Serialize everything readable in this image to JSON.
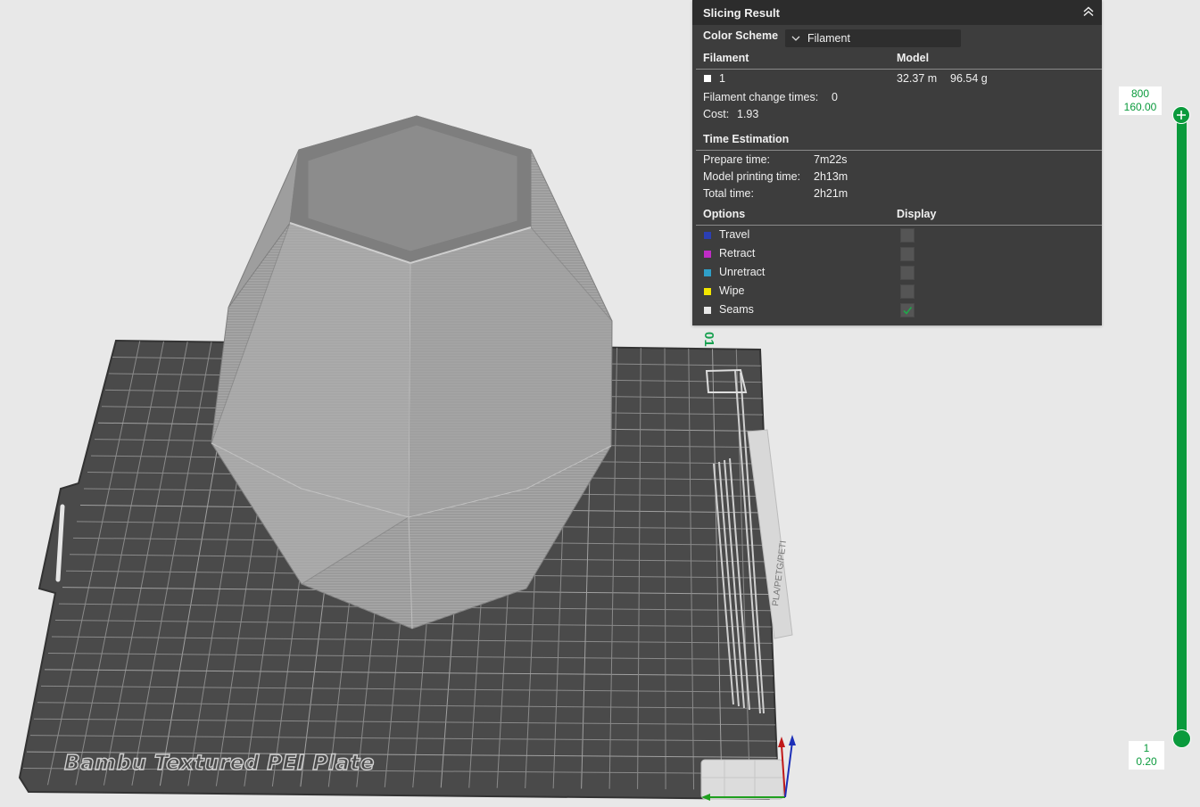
{
  "panel": {
    "title": "Slicing Result",
    "color_scheme_label": "Color Scheme",
    "color_scheme_value": "Filament",
    "filament_header": "Filament",
    "model_header": "Model",
    "filament_id": "1",
    "filament_length": "32.37 m",
    "filament_weight": "96.54 g",
    "change_times_label": "Filament change times:",
    "change_times_value": "0",
    "cost_label": "Cost:",
    "cost_value": "1.93",
    "time_header": "Time Estimation",
    "prepare_label": "Prepare time:",
    "prepare_value": "7m22s",
    "model_print_label": "Model printing time:",
    "model_print_value": "2h13m",
    "total_label": "Total time:",
    "total_value": "2h21m",
    "options_header": "Options",
    "display_header": "Display",
    "options": [
      {
        "label": "Travel",
        "color": "#2b3fb3",
        "checked": false
      },
      {
        "label": "Retract",
        "color": "#c02cc6",
        "checked": false
      },
      {
        "label": "Unretract",
        "color": "#2f9fc8",
        "checked": false
      },
      {
        "label": "Wipe",
        "color": "#f2e600",
        "checked": false
      },
      {
        "label": "Seams",
        "color": "#e8e8e8",
        "checked": true
      }
    ]
  },
  "slider": {
    "top_layer": "800",
    "top_height": "160.00",
    "bottom_layer": "1",
    "bottom_height": "0.20",
    "accent": "#0a9a3c"
  },
  "plate": {
    "label": "Bambu Textured PEI Plate",
    "side_text": "PLA/PETG/PETI",
    "plate_number": "01"
  }
}
